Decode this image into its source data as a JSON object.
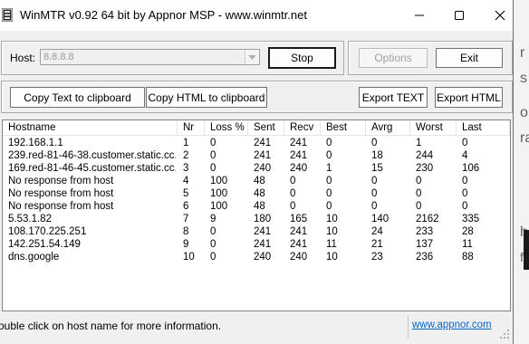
{
  "window": {
    "title": "WinMTR v0.92 64 bit by Appnor MSP - www.winmtr.net"
  },
  "controls": {
    "host_label": "Host:",
    "host_value": "8.8.8.8",
    "stop_label": "Stop",
    "options_label": "Options",
    "exit_label": "Exit",
    "copy_text_label": "Copy Text to clipboard",
    "copy_html_label": "Copy HTML to clipboard",
    "export_text_label": "Export TEXT",
    "export_html_label": "Export HTML"
  },
  "table": {
    "headers": [
      "Hostname",
      "Nr",
      "Loss %",
      "Sent",
      "Recv",
      "Best",
      "Avrg",
      "Worst",
      "Last"
    ],
    "rows": [
      [
        "192.168.1.1",
        "1",
        "0",
        "241",
        "241",
        "0",
        "0",
        "1",
        "0"
      ],
      [
        "239.red-81-46-38.customer.static.cc...",
        "2",
        "0",
        "241",
        "241",
        "0",
        "18",
        "244",
        "4"
      ],
      [
        "169.red-81-46-45.customer.static.cc...",
        "3",
        "0",
        "240",
        "240",
        "1",
        "15",
        "230",
        "106"
      ],
      [
        "No response from host",
        "4",
        "100",
        "48",
        "0",
        "0",
        "0",
        "0",
        "0"
      ],
      [
        "No response from host",
        "5",
        "100",
        "48",
        "0",
        "0",
        "0",
        "0",
        "0"
      ],
      [
        "No response from host",
        "6",
        "100",
        "48",
        "0",
        "0",
        "0",
        "0",
        "0"
      ],
      [
        "5.53.1.82",
        "7",
        "9",
        "180",
        "165",
        "10",
        "140",
        "2162",
        "335"
      ],
      [
        "108.170.225.251",
        "8",
        "0",
        "241",
        "241",
        "10",
        "24",
        "233",
        "28"
      ],
      [
        "142.251.54.149",
        "9",
        "0",
        "241",
        "241",
        "11",
        "21",
        "137",
        "11"
      ],
      [
        "dns.google",
        "10",
        "0",
        "240",
        "240",
        "10",
        "23",
        "236",
        "88"
      ]
    ]
  },
  "status": {
    "text": "ouble click on host name for more information.",
    "link": "www.appnor.com"
  },
  "background_fragments": [
    "r",
    "s",
    "o",
    "ra",
    "he",
    "fo"
  ]
}
